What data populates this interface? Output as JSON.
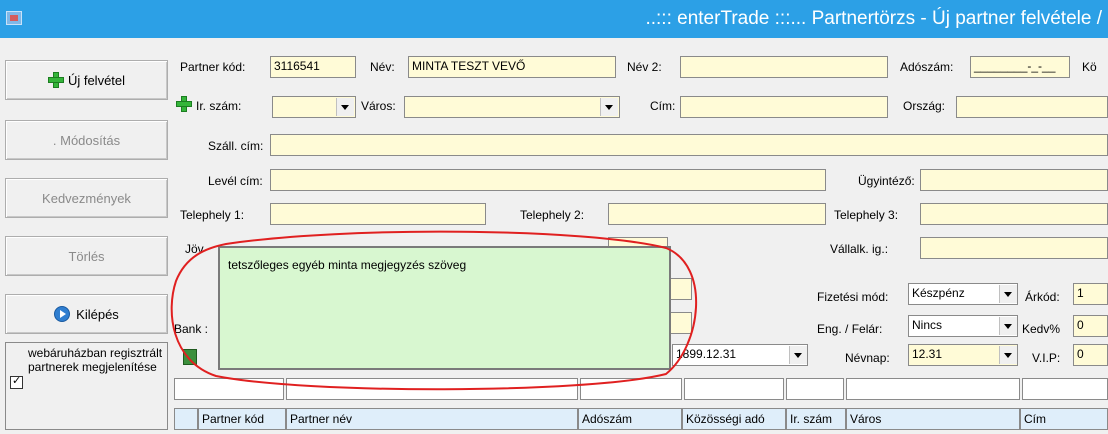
{
  "window": {
    "title": "..::: enterTrade :::... Partnertörzs - Új partner felvétele /"
  },
  "left": {
    "new_button": "Új felvétel",
    "modify_button": ". Módosítás",
    "discounts_button": "Kedvezmények",
    "delete_button": "Törlés",
    "exit_button": "Kilépés",
    "web_checkbox_label": "webáruházban regisztrált partnerek megjelenítése",
    "web_checkbox_checked": true
  },
  "form": {
    "partner_kod_label": "Partner kód:",
    "partner_kod_value": "3116541",
    "nev_label": "Név:",
    "nev_value": "MINTA TESZT VEVŐ",
    "nev2_label": "Név 2:",
    "nev2_value": "",
    "adoszam_label": "Adószám:",
    "adoszam_value": "________-_-__",
    "ko_label": "Kö",
    "irszam_label": "Ir. szám:",
    "varos_label": "Város:",
    "cim_label": "Cím:",
    "orszag_label": "Ország:",
    "szall_cim_label": "Száll. cím:",
    "level_cim_label": "Levél cím:",
    "ugyintezo_label": "Ügyintéző:",
    "telephely1_label": "Telephely 1:",
    "telephely2_label": "Telephely 2:",
    "telephely3_label": "Telephely 3:",
    "jov_label": "Jöv",
    "vallalk_label": "Vállalk. ig.:",
    "bank_label": "Bank :",
    "fizetesi_mod_label": "Fizetési mód:",
    "fizetesi_mod_value": "Készpénz",
    "arkod_label": "Árkód:",
    "arkod_value": "1",
    "eng_felar_label": "Eng. / Felár:",
    "eng_felar_value": "Nincs",
    "kedv_label": "Kedv%",
    "kedv_value": "0",
    "date_value": "1899.12.31",
    "nevnap_label": "Névnap:",
    "nevnap_value": "12.31",
    "vip_label": "V.I.P:",
    "vip_value": "0",
    "memo_text": "tetszőleges egyéb minta megjegyzés szöveg"
  },
  "grid": {
    "columns": [
      "Partner kód",
      "Partner név",
      "Adószám",
      "Közösségi adó",
      "Ir. szám",
      "Város",
      "Cím"
    ]
  },
  "colors": {
    "title_bar": "#2ca0e6",
    "field_bg": "#fffbd7",
    "memo_bg": "#d8f7d0",
    "annotation": "#e02020"
  }
}
